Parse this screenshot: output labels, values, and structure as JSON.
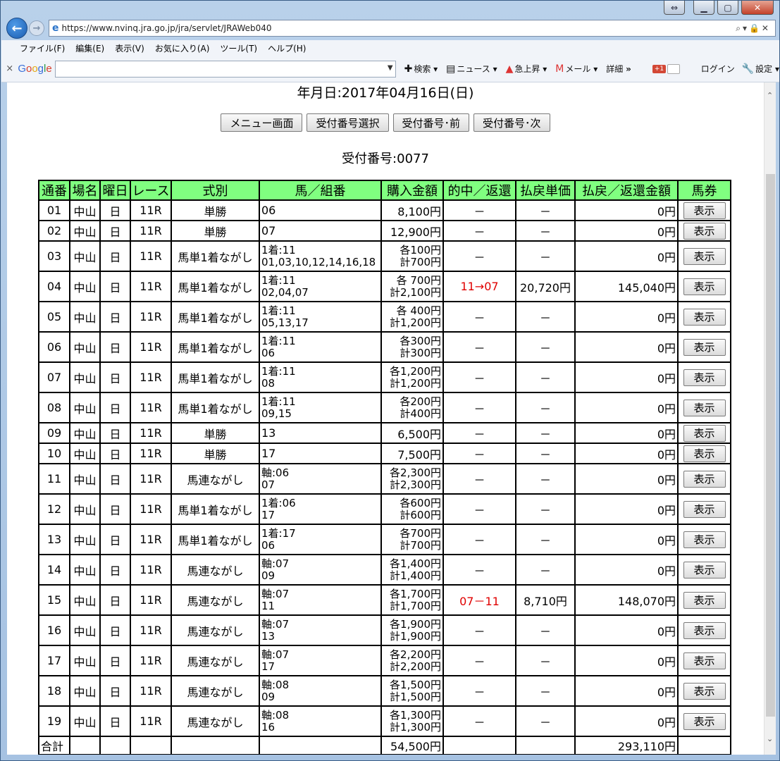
{
  "browser": {
    "url": "https://www.nvinq.jra.go.jp/jra/servlet/JRAWeb040",
    "menu": [
      "ファイル(F)",
      "編集(E)",
      "表示(V)",
      "お気に入り(A)",
      "ツール(T)",
      "ヘルプ(H)"
    ],
    "toolbar": {
      "close": "×",
      "search_label": "検索",
      "news_label": "ニュース",
      "trend_label": "急上昇",
      "mail_label": "メール",
      "details_label": "詳細",
      "details_suffix": "»",
      "gplus_label": "+1",
      "login_label": "ログイン",
      "settings_label": "設定"
    }
  },
  "page": {
    "date_line": "年月日:2017年04月16日(日)",
    "buttons": {
      "menu": "メニュー画面",
      "select": "受付番号選択",
      "prev": "受付番号･前",
      "next": "受付番号･次"
    },
    "receipt": "受付番号:0077"
  },
  "table": {
    "headers": [
      "通番",
      "場名",
      "曜日",
      "レース",
      "式別",
      "馬／組番",
      "購入金額",
      "的中／返還",
      "払戻単価",
      "払戻／返還金額",
      "馬券"
    ],
    "view_label": "表示",
    "rows": [
      {
        "no": "01",
        "place": "中山",
        "day": "日",
        "race": "11R",
        "type": "単勝",
        "combo1": "06",
        "combo2": "",
        "amt1": "8,100円",
        "amt2": "",
        "hit": "－",
        "unit": "－",
        "pay": "0円",
        "two": false,
        "win": false
      },
      {
        "no": "02",
        "place": "中山",
        "day": "日",
        "race": "11R",
        "type": "単勝",
        "combo1": "07",
        "combo2": "",
        "amt1": "12,900円",
        "amt2": "",
        "hit": "－",
        "unit": "－",
        "pay": "0円",
        "two": false,
        "win": false
      },
      {
        "no": "03",
        "place": "中山",
        "day": "日",
        "race": "11R",
        "type": "馬単1着ながし",
        "combo1": "1着:11",
        "combo2": "01,03,10,12,14,16,18",
        "amt1": "各100円",
        "amt2": "計700円",
        "hit": "－",
        "unit": "－",
        "pay": "0円",
        "two": true,
        "win": false
      },
      {
        "no": "04",
        "place": "中山",
        "day": "日",
        "race": "11R",
        "type": "馬単1着ながし",
        "combo1": "1着:11",
        "combo2": "02,04,07",
        "amt1": "各 700円",
        "amt2": "計2,100円",
        "hit": "11→07",
        "unit": "20,720円",
        "pay": "145,040円",
        "two": true,
        "win": true
      },
      {
        "no": "05",
        "place": "中山",
        "day": "日",
        "race": "11R",
        "type": "馬単1着ながし",
        "combo1": "1着:11",
        "combo2": "05,13,17",
        "amt1": "各 400円",
        "amt2": "計1,200円",
        "hit": "－",
        "unit": "－",
        "pay": "0円",
        "two": true,
        "win": false
      },
      {
        "no": "06",
        "place": "中山",
        "day": "日",
        "race": "11R",
        "type": "馬単1着ながし",
        "combo1": "1着:11",
        "combo2": "06",
        "amt1": "各300円",
        "amt2": "計300円",
        "hit": "－",
        "unit": "－",
        "pay": "0円",
        "two": true,
        "win": false
      },
      {
        "no": "07",
        "place": "中山",
        "day": "日",
        "race": "11R",
        "type": "馬単1着ながし",
        "combo1": "1着:11",
        "combo2": "08",
        "amt1": "各1,200円",
        "amt2": "計1,200円",
        "hit": "－",
        "unit": "－",
        "pay": "0円",
        "two": true,
        "win": false
      },
      {
        "no": "08",
        "place": "中山",
        "day": "日",
        "race": "11R",
        "type": "馬単1着ながし",
        "combo1": "1着:11",
        "combo2": "09,15",
        "amt1": "各200円",
        "amt2": "計400円",
        "hit": "－",
        "unit": "－",
        "pay": "0円",
        "two": true,
        "win": false
      },
      {
        "no": "09",
        "place": "中山",
        "day": "日",
        "race": "11R",
        "type": "単勝",
        "combo1": "13",
        "combo2": "",
        "amt1": "6,500円",
        "amt2": "",
        "hit": "－",
        "unit": "－",
        "pay": "0円",
        "two": false,
        "win": false
      },
      {
        "no": "10",
        "place": "中山",
        "day": "日",
        "race": "11R",
        "type": "単勝",
        "combo1": "17",
        "combo2": "",
        "amt1": "7,500円",
        "amt2": "",
        "hit": "－",
        "unit": "－",
        "pay": "0円",
        "two": false,
        "win": false
      },
      {
        "no": "11",
        "place": "中山",
        "day": "日",
        "race": "11R",
        "type": "馬連ながし",
        "combo1": "軸:06",
        "combo2": "07",
        "amt1": "各2,300円",
        "amt2": "計2,300円",
        "hit": "－",
        "unit": "－",
        "pay": "0円",
        "two": true,
        "win": false
      },
      {
        "no": "12",
        "place": "中山",
        "day": "日",
        "race": "11R",
        "type": "馬単1着ながし",
        "combo1": "1着:06",
        "combo2": "17",
        "amt1": "各600円",
        "amt2": "計600円",
        "hit": "－",
        "unit": "－",
        "pay": "0円",
        "two": true,
        "win": false
      },
      {
        "no": "13",
        "place": "中山",
        "day": "日",
        "race": "11R",
        "type": "馬単1着ながし",
        "combo1": "1着:17",
        "combo2": "06",
        "amt1": "各700円",
        "amt2": "計700円",
        "hit": "－",
        "unit": "－",
        "pay": "0円",
        "two": true,
        "win": false
      },
      {
        "no": "14",
        "place": "中山",
        "day": "日",
        "race": "11R",
        "type": "馬連ながし",
        "combo1": "軸:07",
        "combo2": "09",
        "amt1": "各1,400円",
        "amt2": "計1,400円",
        "hit": "－",
        "unit": "－",
        "pay": "0円",
        "two": true,
        "win": false
      },
      {
        "no": "15",
        "place": "中山",
        "day": "日",
        "race": "11R",
        "type": "馬連ながし",
        "combo1": "軸:07",
        "combo2": "11",
        "amt1": "各1,700円",
        "amt2": "計1,700円",
        "hit": "07－11",
        "unit": "8,710円",
        "pay": "148,070円",
        "two": true,
        "win": true
      },
      {
        "no": "16",
        "place": "中山",
        "day": "日",
        "race": "11R",
        "type": "馬連ながし",
        "combo1": "軸:07",
        "combo2": "13",
        "amt1": "各1,900円",
        "amt2": "計1,900円",
        "hit": "－",
        "unit": "－",
        "pay": "0円",
        "two": true,
        "win": false
      },
      {
        "no": "17",
        "place": "中山",
        "day": "日",
        "race": "11R",
        "type": "馬連ながし",
        "combo1": "軸:07",
        "combo2": "17",
        "amt1": "各2,200円",
        "amt2": "計2,200円",
        "hit": "－",
        "unit": "－",
        "pay": "0円",
        "two": true,
        "win": false
      },
      {
        "no": "18",
        "place": "中山",
        "day": "日",
        "race": "11R",
        "type": "馬連ながし",
        "combo1": "軸:08",
        "combo2": "09",
        "amt1": "各1,500円",
        "amt2": "計1,500円",
        "hit": "－",
        "unit": "－",
        "pay": "0円",
        "two": true,
        "win": false
      },
      {
        "no": "19",
        "place": "中山",
        "day": "日",
        "race": "11R",
        "type": "馬連ながし",
        "combo1": "軸:08",
        "combo2": "16",
        "amt1": "各1,300円",
        "amt2": "計1,300円",
        "hit": "－",
        "unit": "－",
        "pay": "0円",
        "two": true,
        "win": false
      }
    ],
    "total": {
      "label": "合計",
      "amount": "54,500円",
      "payout": "293,110円"
    }
  },
  "colors": {
    "header_bg": "#80ff80",
    "hit_text": "#e00000"
  }
}
